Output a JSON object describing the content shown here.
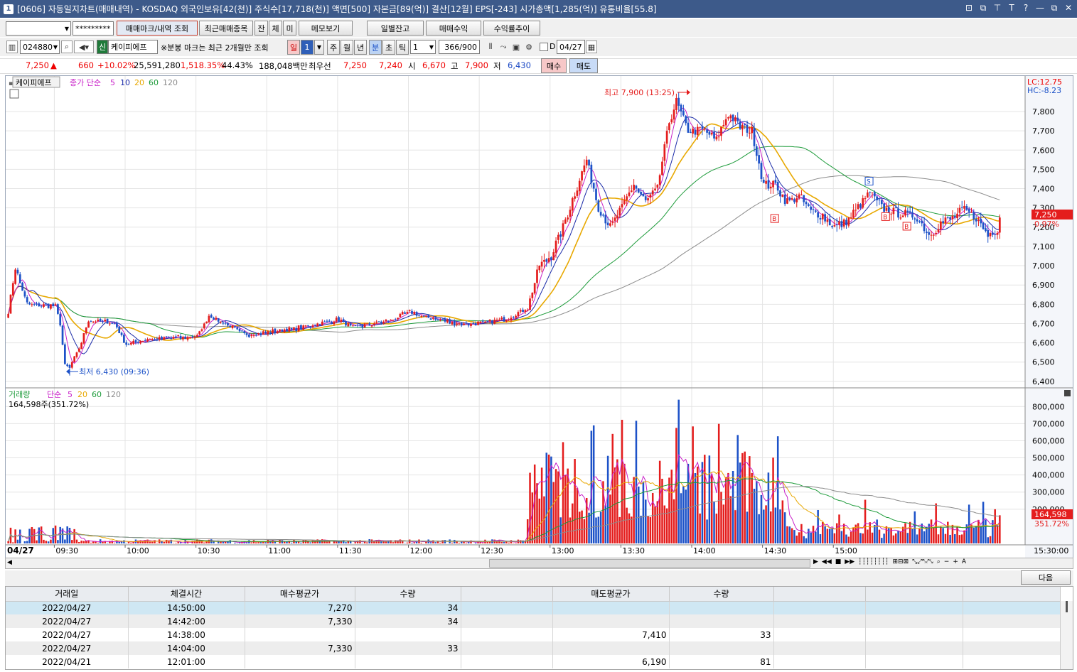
{
  "window": {
    "number": "1",
    "title": "[0606] 자동일지차트(매매내역) - KOSDAQ 외국인보유[42(천)] 주식수[17,718(천)] 액면[500] 자본금[89(억)] 결산[12월] EPS[-243] 시가총액[1,285(억)] 유통비율[55.8]",
    "controls": [
      "⊡",
      "⧉",
      "⊤",
      "T",
      "?",
      "—",
      "⧉",
      "✕"
    ]
  },
  "toolbar1": {
    "account_value": "",
    "password_mask": "*********",
    "buttons": [
      "매매마크/내역 조회",
      "최근매매종목",
      "잔",
      "체",
      "미",
      "메모보기",
      "일별잔고",
      "매매수익",
      "수익률추이"
    ]
  },
  "toolbar2": {
    "code": "024880",
    "stock_type_badge": "신",
    "stock_name": "케이피에프",
    "note": "※분봉 마크는 최근 2개월만 조회",
    "period_tabs": [
      "일",
      "1",
      "주",
      "월",
      "년",
      "분",
      "초",
      "틱"
    ],
    "interval": "1",
    "count": "366/900",
    "d_label": "D",
    "date": "04/27"
  },
  "quote": {
    "price": "7,250",
    "arrow": "▲",
    "change": "660",
    "change_pct": "+10.02%",
    "volume": "25,591,280",
    "vol_ratio": "1,518.35%",
    "turnover": "44.43%",
    "amount": "188,048백만",
    "best_label": "최우선",
    "best_ask": "7,250",
    "best_bid": "7,240",
    "open_label": "시",
    "open": "6,670",
    "high_label": "고",
    "high": "7,900",
    "low_label": "저",
    "low": "6,430",
    "buy_btn": "매수",
    "sell_btn": "매도"
  },
  "price_panel": {
    "name_tag": "케이피에프",
    "ma_label": "종가 단순",
    "ma_periods": [
      "5",
      "10",
      "20",
      "60",
      "120"
    ],
    "lc": "LC:12.75",
    "hc": "HC:-8.23",
    "current_label": "7,250",
    "current_pct": "0.97%",
    "high_annot": "최고 7,900 (13:25)",
    "low_annot": "최저 6,430 (09:36)",
    "buy_mark": "B",
    "sell_mark": "S"
  },
  "volume_panel": {
    "title": "거래량",
    "ma_label": "단순",
    "ma_periods": [
      "5",
      "20",
      "60",
      "120"
    ],
    "info": "164,598주(351.72%)",
    "current_label": "164,598",
    "current_pct": "351.72%"
  },
  "colors": {
    "up": "#e41d1d",
    "down": "#1d52c8",
    "ma5": "#c81fc8",
    "ma10": "#1a2aa8",
    "ma20": "#e8a800",
    "ma60": "#1d9b3a",
    "ma120": "#8c8c8c"
  },
  "chart_data": {
    "type": "candlestick",
    "date_label": "04/27",
    "x_ticks": [
      "09:30",
      "10:00",
      "10:30",
      "11:00",
      "11:30",
      "12:00",
      "12:30",
      "13:00",
      "13:30",
      "14:00",
      "14:30",
      "15:00"
    ],
    "x_end_label": "15:30:00",
    "y_ticks": [
      "7,800",
      "7,700",
      "7,600",
      "7,500",
      "7,400",
      "7,300",
      "7,200",
      "7,100",
      "7,000",
      "6,900",
      "6,800",
      "6,700",
      "6,600",
      "6,500",
      "6,400"
    ],
    "ylim": [
      6370,
      7940
    ],
    "vol_ticks": [
      "800,000",
      "700,000",
      "600,000",
      "500,000",
      "400,000",
      "300,000",
      "200,000"
    ],
    "vol_ylim": [
      0,
      880000
    ],
    "price_path": [
      [
        0,
        6760
      ],
      [
        3,
        6990
      ],
      [
        8,
        6800
      ],
      [
        20,
        6790
      ],
      [
        22,
        6700
      ],
      [
        24,
        6480
      ],
      [
        26,
        6470
      ],
      [
        30,
        6570
      ],
      [
        34,
        6720
      ],
      [
        45,
        6700
      ],
      [
        50,
        6590
      ],
      [
        60,
        6620
      ],
      [
        80,
        6630
      ],
      [
        85,
        6740
      ],
      [
        95,
        6680
      ],
      [
        100,
        6640
      ],
      [
        120,
        6670
      ],
      [
        140,
        6720
      ],
      [
        145,
        6680
      ],
      [
        160,
        6710
      ],
      [
        170,
        6760
      ],
      [
        175,
        6740
      ],
      [
        190,
        6700
      ],
      [
        200,
        6700
      ],
      [
        210,
        6720
      ],
      [
        215,
        6750
      ],
      [
        220,
        6780
      ],
      [
        225,
        7000
      ],
      [
        230,
        7050
      ],
      [
        235,
        7200
      ],
      [
        240,
        7380
      ],
      [
        245,
        7550
      ],
      [
        250,
        7300
      ],
      [
        255,
        7200
      ],
      [
        260,
        7300
      ],
      [
        265,
        7420
      ],
      [
        270,
        7330
      ],
      [
        275,
        7400
      ],
      [
        280,
        7750
      ],
      [
        283,
        7850
      ],
      [
        288,
        7700
      ],
      [
        295,
        7700
      ],
      [
        300,
        7650
      ],
      [
        305,
        7790
      ],
      [
        310,
        7720
      ],
      [
        315,
        7700
      ],
      [
        320,
        7420
      ],
      [
        325,
        7420
      ],
      [
        330,
        7330
      ],
      [
        335,
        7360
      ],
      [
        340,
        7280
      ],
      [
        345,
        7260
      ],
      [
        350,
        7200
      ],
      [
        355,
        7230
      ],
      [
        360,
        7300
      ],
      [
        365,
        7380
      ],
      [
        370,
        7300
      ],
      [
        375,
        7280
      ],
      [
        380,
        7270
      ],
      [
        385,
        7250
      ],
      [
        390,
        7160
      ],
      [
        395,
        7220
      ],
      [
        400,
        7250
      ],
      [
        405,
        7290
      ],
      [
        410,
        7250
      ],
      [
        415,
        7160
      ],
      [
        420,
        7200
      ]
    ],
    "markers": [
      {
        "type": "B",
        "x": 325,
        "price": 7280
      },
      {
        "type": "S",
        "x": 365,
        "price": 7400
      },
      {
        "type": "B",
        "x": 372,
        "price": 7290
      },
      {
        "type": "B",
        "x": 381,
        "price": 7240
      }
    ],
    "high": {
      "x": 284,
      "price": 7900,
      "time": "13:25"
    },
    "low": {
      "x": 26,
      "price": 6430,
      "time": "09:36"
    }
  },
  "tabs_scroll": {
    "next_btn": "다음"
  },
  "table": {
    "headers": [
      "거래일",
      "체결시간",
      "매수평균가",
      "수량",
      "",
      "매도평균가",
      "수량",
      "",
      "",
      ""
    ],
    "rows": [
      [
        "2022/04/27",
        "14:50:00",
        "7,270",
        "34",
        "",
        "",
        "",
        "",
        "",
        ""
      ],
      [
        "2022/04/27",
        "14:42:00",
        "7,330",
        "34",
        "",
        "",
        "",
        "",
        "",
        ""
      ],
      [
        "2022/04/27",
        "14:38:00",
        "",
        "",
        "",
        "7,410",
        "33",
        "",
        "",
        ""
      ],
      [
        "2022/04/27",
        "14:04:00",
        "7,330",
        "33",
        "",
        "",
        "",
        "",
        "",
        ""
      ],
      [
        "2022/04/21",
        "12:01:00",
        "",
        "",
        "",
        "6,190",
        "81",
        "",
        "",
        ""
      ]
    ]
  }
}
